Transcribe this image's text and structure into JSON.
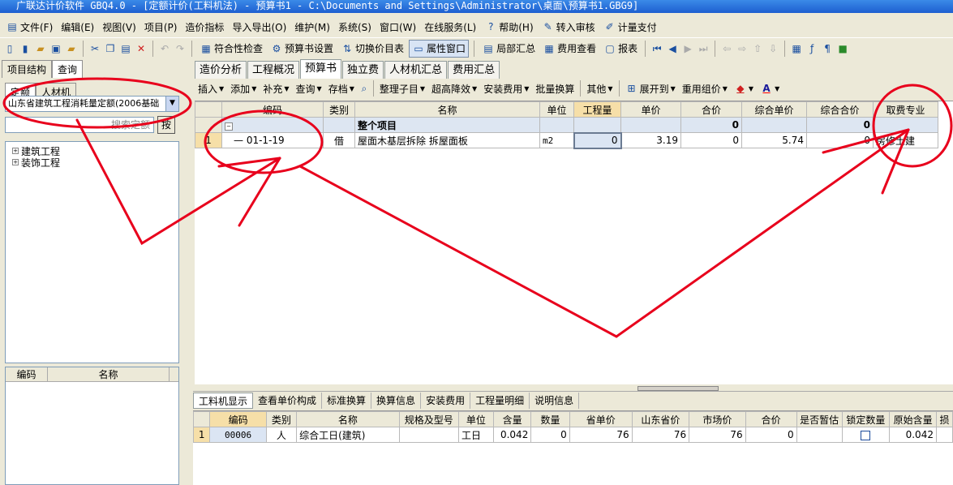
{
  "title": "广联达计价软件 GBQ4.0 - [定额计价(工料机法) - 预算书1 - C:\\Documents and Settings\\Administrator\\桌面\\预算书1.GBG9]",
  "menu": [
    "文件(F)",
    "编辑(E)",
    "视图(V)",
    "项目(P)",
    "造价指标",
    "导入导出(O)",
    "维护(M)",
    "系统(S)",
    "窗口(W)",
    "在线服务(L)",
    "帮助(H)",
    "转入审核",
    "计量支付"
  ],
  "toolbar1": {
    "check": "符合性检查",
    "budget_settings": "预算书设置",
    "switch_price": "切换价目表",
    "property_window": "属性窗口",
    "local_summary": "局部汇总",
    "fee_view": "费用查看",
    "report": "报表"
  },
  "left": {
    "tabs": [
      "项目结构",
      "查询"
    ],
    "subtabs": [
      "定额",
      "人材机"
    ],
    "quota_select": "山东省建筑工程消耗量定额(2006基础",
    "search_placeholder": "搜索定额",
    "search_btn": "按",
    "tree": [
      "建筑工程",
      "装饰工程"
    ],
    "grid_headers": [
      "编码",
      "名称"
    ]
  },
  "tabs": [
    "造价分析",
    "工程概况",
    "预算书",
    "独立费",
    "人材机汇总",
    "费用汇总"
  ],
  "toolbar2": [
    "插入",
    "添加",
    "补充",
    "查询",
    "存档",
    "整理子目",
    "超高降效",
    "安装费用",
    "批量换算",
    "其他",
    "展开到",
    "重用组价"
  ],
  "main": {
    "headers": [
      "编码",
      "类别",
      "名称",
      "单位",
      "工程量",
      "单价",
      "合价",
      "综合单价",
      "综合合价",
      "取费专业"
    ],
    "group_row": {
      "name": "整个项目",
      "total": "0",
      "comp_total": "0"
    },
    "rows": [
      {
        "no": "1",
        "code": "01-1-19",
        "type": "借",
        "name": "屋面木基层拆除 拆屋面板",
        "unit": "m2",
        "qty": "0",
        "price": "3.19",
        "total": "0",
        "comp_price": "5.74",
        "comp_total": "0",
        "specialty": "房修土建"
      }
    ]
  },
  "bottom_tabs": [
    "工料机显示",
    "查看单价构成",
    "标准换算",
    "换算信息",
    "安装费用",
    "工程量明细",
    "说明信息"
  ],
  "bottom": {
    "headers": [
      "编码",
      "类别",
      "名称",
      "规格及型号",
      "单位",
      "含量",
      "数量",
      "省单价",
      "山东省价",
      "市场价",
      "合价",
      "是否暂估",
      "锁定数量",
      "原始含量",
      "损"
    ],
    "rows": [
      {
        "no": "1",
        "code": "00006",
        "type": "人",
        "name": "综合工日(建筑)",
        "spec": "",
        "unit": "工日",
        "content": "0.042",
        "qty": "0",
        "prov_price": "76",
        "sd_price": "76",
        "market": "76",
        "total": "0",
        "est": "",
        "orig": "0.042"
      }
    ]
  }
}
